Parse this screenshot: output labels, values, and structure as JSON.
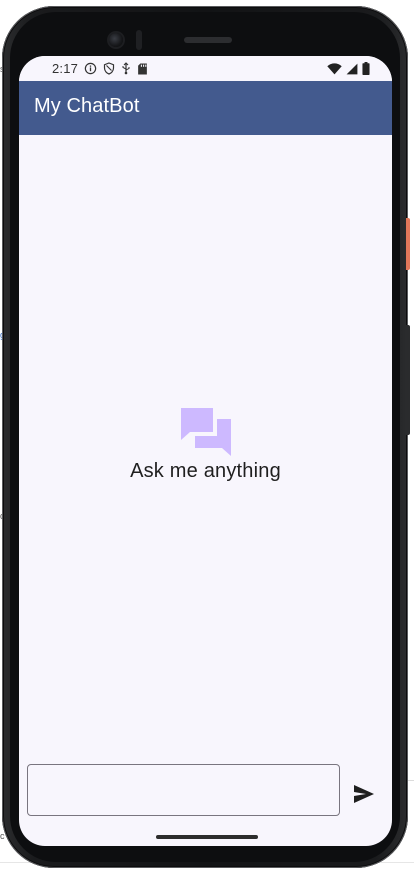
{
  "background_fragments": [
    "s",
    "g",
    "c",
    "c"
  ],
  "status_bar": {
    "time": "2:17",
    "left_icons": [
      "info-icon",
      "shield-icon",
      "usb-icon",
      "sd-card-icon"
    ],
    "right_icons": [
      "wifi-icon",
      "cell-signal-icon",
      "battery-icon"
    ]
  },
  "app_bar": {
    "title": "My ChatBot",
    "color": "#435a8e"
  },
  "empty_state": {
    "icon": "chat-bubbles-icon",
    "icon_color": "#cdb9ff",
    "message": "Ask me anything"
  },
  "composer": {
    "input_value": "",
    "input_placeholder": "",
    "send_icon": "send-icon"
  },
  "colors": {
    "screen_background": "#f8f6fd",
    "app_bar": "#435a8e",
    "accent_icon": "#cdb9ff"
  }
}
